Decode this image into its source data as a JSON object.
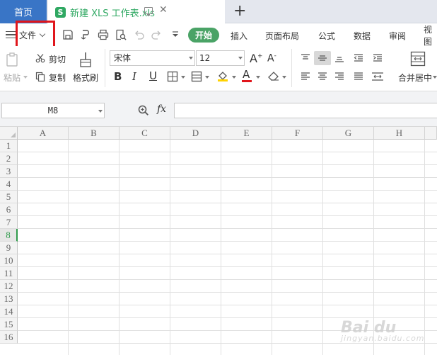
{
  "tabs": {
    "home_label": "首页",
    "doc_logo": "S",
    "doc_title": "新建 XLS 工作表.xls",
    "close_glyph": "✕",
    "add_glyph": "+"
  },
  "menu": {
    "file_label": "文件",
    "tabs": [
      "开始",
      "插入",
      "页面布局",
      "公式",
      "数据",
      "审阅",
      "视图"
    ]
  },
  "ribbon": {
    "paste_label": "粘贴",
    "cut_label": "剪切",
    "copy_label": "复制",
    "format_painter_label": "格式刷",
    "font_name": "宋体",
    "font_size": "12",
    "bold_label": "B",
    "italic_label": "I",
    "underline_label": "U",
    "font_color_label": "A",
    "increase_font_label": "A",
    "decrease_font_label": "A",
    "merge_label": "合并居中",
    "accent_color": "#4aa366",
    "font_color_bar": "#e0161c",
    "fill_color_bar": "#ffd200"
  },
  "formula_bar": {
    "cell_ref": "M8",
    "fx_label": "fx",
    "formula": ""
  },
  "sheet": {
    "columns": [
      "A",
      "B",
      "C",
      "D",
      "E",
      "F",
      "G",
      "H"
    ],
    "rows": [
      "1",
      "2",
      "3",
      "4",
      "5",
      "6",
      "7",
      "8",
      "9",
      "10",
      "11",
      "12",
      "13",
      "14",
      "15",
      "16"
    ],
    "active_row": "8",
    "active_color": "#2f9a4b"
  },
  "watermark": {
    "brand": "Bai du",
    "sub": "jingyan.baidu.com"
  }
}
